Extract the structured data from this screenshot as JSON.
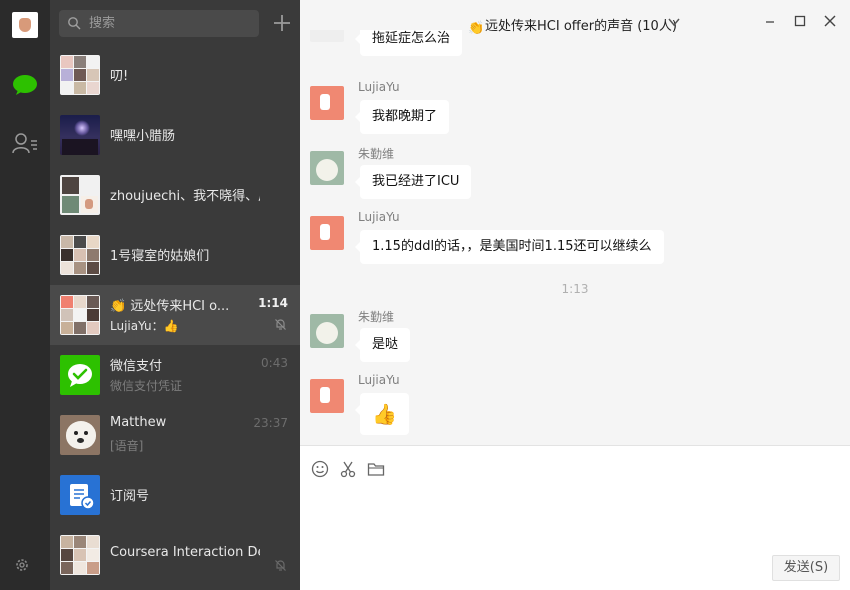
{
  "search": {
    "placeholder": "搜索"
  },
  "conversations": [
    {
      "name": "叨!"
    },
    {
      "name": "嘿嘿小腊肠"
    },
    {
      "name": "zhoujuechi、我不晓得、周zcl"
    },
    {
      "name": "1号寝室的姑娘们"
    },
    {
      "name": "远处传来HCI o...",
      "time": "1:14",
      "preview": "LujiaYu：",
      "preview_emoji": "👍",
      "active": true,
      "muted": true
    },
    {
      "name": "微信支付",
      "time": "0:43",
      "preview": "微信支付凭证"
    },
    {
      "name": "Matthew",
      "time": "23:37",
      "preview": "[语音]"
    },
    {
      "name": "订阅号"
    },
    {
      "name": "Coursera Interaction Design",
      "muted": true
    }
  ],
  "chat": {
    "title": "远处传来HCI offer的声音 (10人)",
    "messages": [
      {
        "sender": "",
        "text": "拖延症怎么治"
      },
      {
        "sender": "LujiaYu",
        "text": "我都晚期了"
      },
      {
        "sender": "朱勤维",
        "text": "我已经进了ICU"
      },
      {
        "sender": "LujiaYu",
        "text": "1.15的ddl的话，，是美国时间1.15还可以继续么"
      },
      {
        "sender": "朱勤维",
        "text": "是哒"
      },
      {
        "sender": "LujiaYu",
        "text": "👍"
      }
    ],
    "timestamp": "1:13",
    "send_label": "发送(S)"
  },
  "colors": {
    "rail": "#2b2b2b",
    "list": "#3a3a3a",
    "active_row": "#4a4a4a",
    "wechat_green": "#2dc100",
    "chat_bg": "#f5f5f5"
  }
}
